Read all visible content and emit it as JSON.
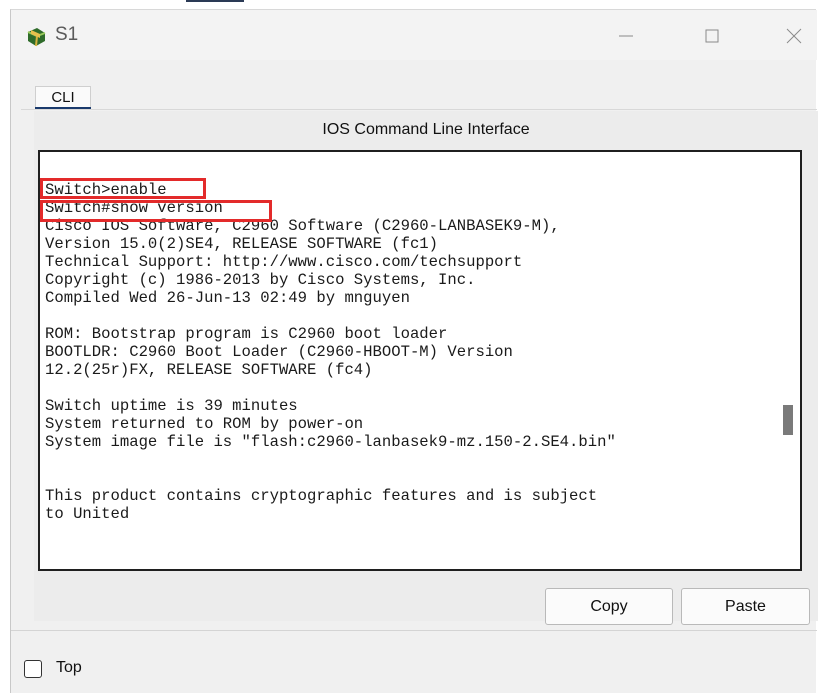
{
  "window": {
    "title": "S1",
    "icon": "switch-app-icon",
    "controls": [
      "minimize-icon",
      "maximize-icon",
      "close-icon"
    ]
  },
  "tabs": [
    {
      "label": "CLI",
      "selected": true
    }
  ],
  "cli": {
    "title": "IOS Command Line Interface",
    "lines": [
      "Switch>enable",
      "Switch#show version",
      "Cisco IOS Software, C2960 Software (C2960-LANBASEK9-M),",
      "Version 15.0(2)SE4, RELEASE SOFTWARE (fc1)",
      "Technical Support: http://www.cisco.com/techsupport",
      "Copyright (c) 1986-2013 by Cisco Systems, Inc.",
      "Compiled Wed 26-Jun-13 02:49 by mnguyen",
      "",
      "ROM: Bootstrap program is C2960 boot loader",
      "BOOTLDR: C2960 Boot Loader (C2960-HBOOT-M) Version",
      "12.2(25r)FX, RELEASE SOFTWARE (fc4)",
      "",
      "Switch uptime is 39 minutes",
      "System returned to ROM by power-on",
      "System image file is \"flash:c2960-lanbasek9-mz.150-2.SE4.bin\"",
      "",
      "",
      "This product contains cryptographic features and is subject",
      "to United"
    ],
    "highlighted_lines": [
      "Switch>enable",
      "Switch#show version"
    ],
    "highlight_color": "#e32a2a"
  },
  "buttons": {
    "copy": "Copy",
    "paste": "Paste"
  },
  "footer": {
    "top_label": "Top",
    "top_checked": false
  }
}
